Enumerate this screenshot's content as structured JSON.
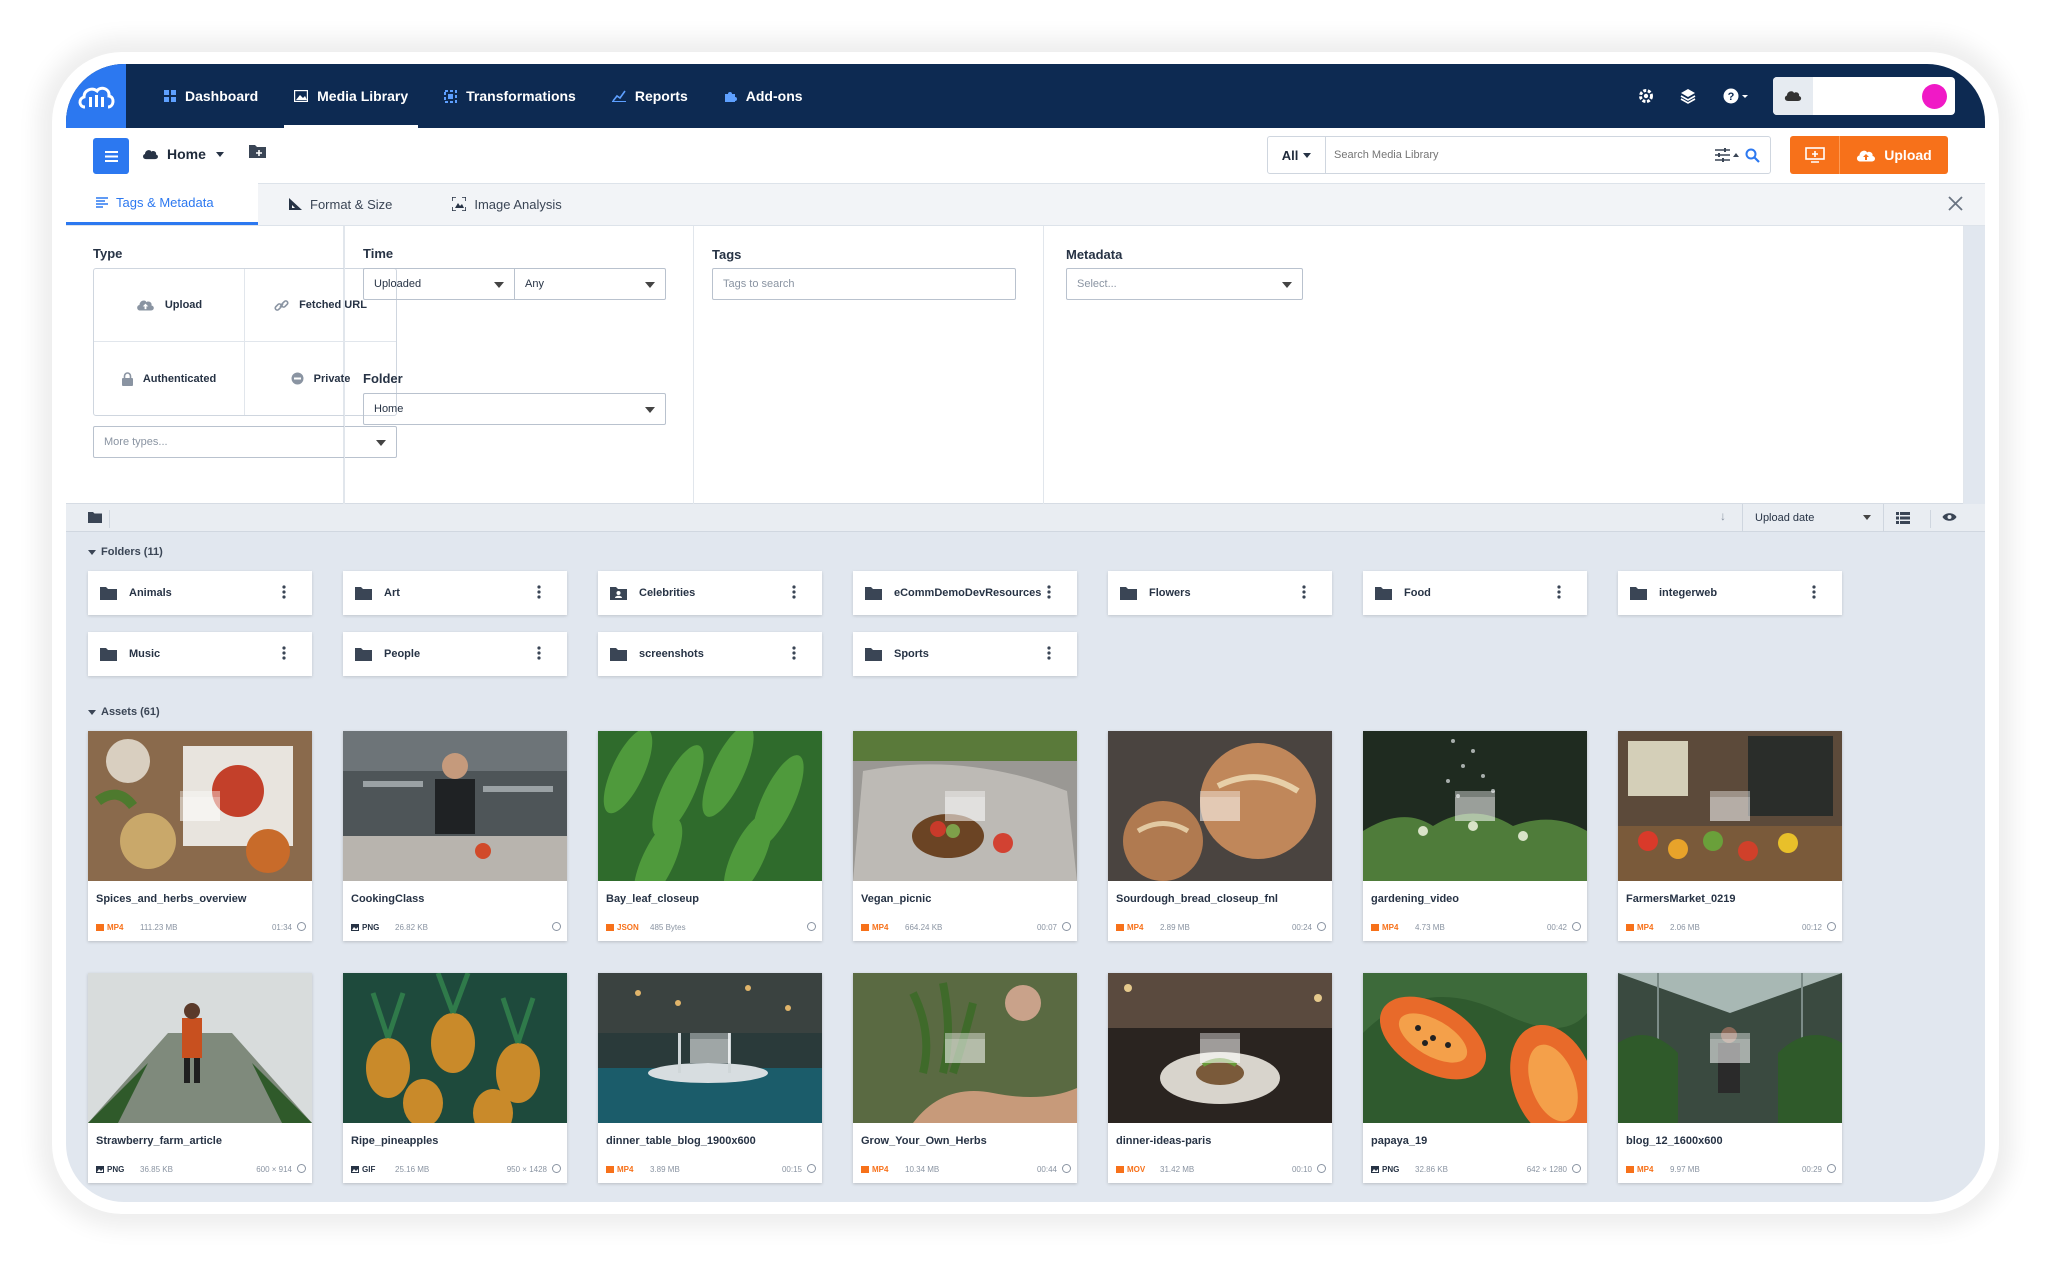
{
  "nav": {
    "items": [
      {
        "label": "Dashboard",
        "icon": "dashboard-icon",
        "active": false
      },
      {
        "label": "Media Library",
        "icon": "media-library-icon",
        "active": true
      },
      {
        "label": "Transformations",
        "icon": "transformations-icon",
        "active": false
      },
      {
        "label": "Reports",
        "icon": "reports-icon",
        "active": false
      },
      {
        "label": "Add-ons",
        "icon": "addons-icon",
        "active": false
      }
    ]
  },
  "toolbar": {
    "breadcrumb_home": "Home",
    "search_scope": "All",
    "search_placeholder": "Search Media Library",
    "upload_label": "Upload"
  },
  "filter_tabs": [
    {
      "label": "Tags & Metadata",
      "active": true
    },
    {
      "label": "Format & Size",
      "active": false
    },
    {
      "label": "Image Analysis",
      "active": false
    }
  ],
  "filters": {
    "type_label": "Type",
    "types": [
      "Upload",
      "Fetched URL",
      "Authenticated",
      "Private"
    ],
    "more_types_placeholder": "More types...",
    "time_label": "Time",
    "time_field": "Uploaded",
    "time_range": "Any",
    "folder_label": "Folder",
    "folder_value": "Home",
    "tags_label": "Tags",
    "tags_placeholder": "Tags to search",
    "metadata_label": "Metadata",
    "metadata_placeholder": "Select..."
  },
  "list": {
    "sort_label": "Upload date",
    "folders_header": "Folders (11)",
    "assets_header": "Assets (61)"
  },
  "folders": [
    "Animals",
    "Art",
    "Celebrities",
    "eCommDemoDevResources",
    "Flowers",
    "Food",
    "integerweb",
    "Music",
    "People",
    "screenshots",
    "Sports"
  ],
  "assets": [
    {
      "name": "Spices_and_herbs_overview",
      "type": "MP4",
      "size": "111.23 MB",
      "extra": "01:34"
    },
    {
      "name": "CookingClass",
      "type": "PNG",
      "size": "26.82 KB",
      "extra": ""
    },
    {
      "name": "Bay_leaf_closeup",
      "type": "JSON",
      "size": "485 Bytes",
      "extra": ""
    },
    {
      "name": "Vegan_picnic",
      "type": "MP4",
      "size": "664.24 KB",
      "extra": "00:07"
    },
    {
      "name": "Sourdough_bread_closeup_fnl",
      "type": "MP4",
      "size": "2.89 MB",
      "extra": "00:24"
    },
    {
      "name": "gardening_video",
      "type": "MP4",
      "size": "4.73 MB",
      "extra": "00:42"
    },
    {
      "name": "FarmersMarket_0219",
      "type": "MP4",
      "size": "2.06 MB",
      "extra": "00:12"
    },
    {
      "name": "Strawberry_farm_article",
      "type": "PNG",
      "size": "36.85 KB",
      "extra": "600 × 914"
    },
    {
      "name": "Ripe_pineapples",
      "type": "GIF",
      "size": "25.16 MB",
      "extra": "950 × 1428"
    },
    {
      "name": "dinner_table_blog_1900x600",
      "type": "MP4",
      "size": "3.89 MB",
      "extra": "00:15"
    },
    {
      "name": "Grow_Your_Own_Herbs",
      "type": "MP4",
      "size": "10.34 MB",
      "extra": "00:44"
    },
    {
      "name": "dinner-ideas-paris",
      "type": "MOV",
      "size": "31.42 MB",
      "extra": "00:10"
    },
    {
      "name": "papaya_19",
      "type": "PNG",
      "size": "32.86 KB",
      "extra": "642 × 1280"
    },
    {
      "name": "blog_12_1600x600",
      "type": "MP4",
      "size": "9.97 MB",
      "extra": "00:29"
    }
  ],
  "colors": {
    "nav_bg": "#0d2a52",
    "accent_blue": "#2c78f0",
    "upload_orange": "#f7711a",
    "avatar": "#f019c6",
    "content_bg": "#e1e7ef"
  }
}
